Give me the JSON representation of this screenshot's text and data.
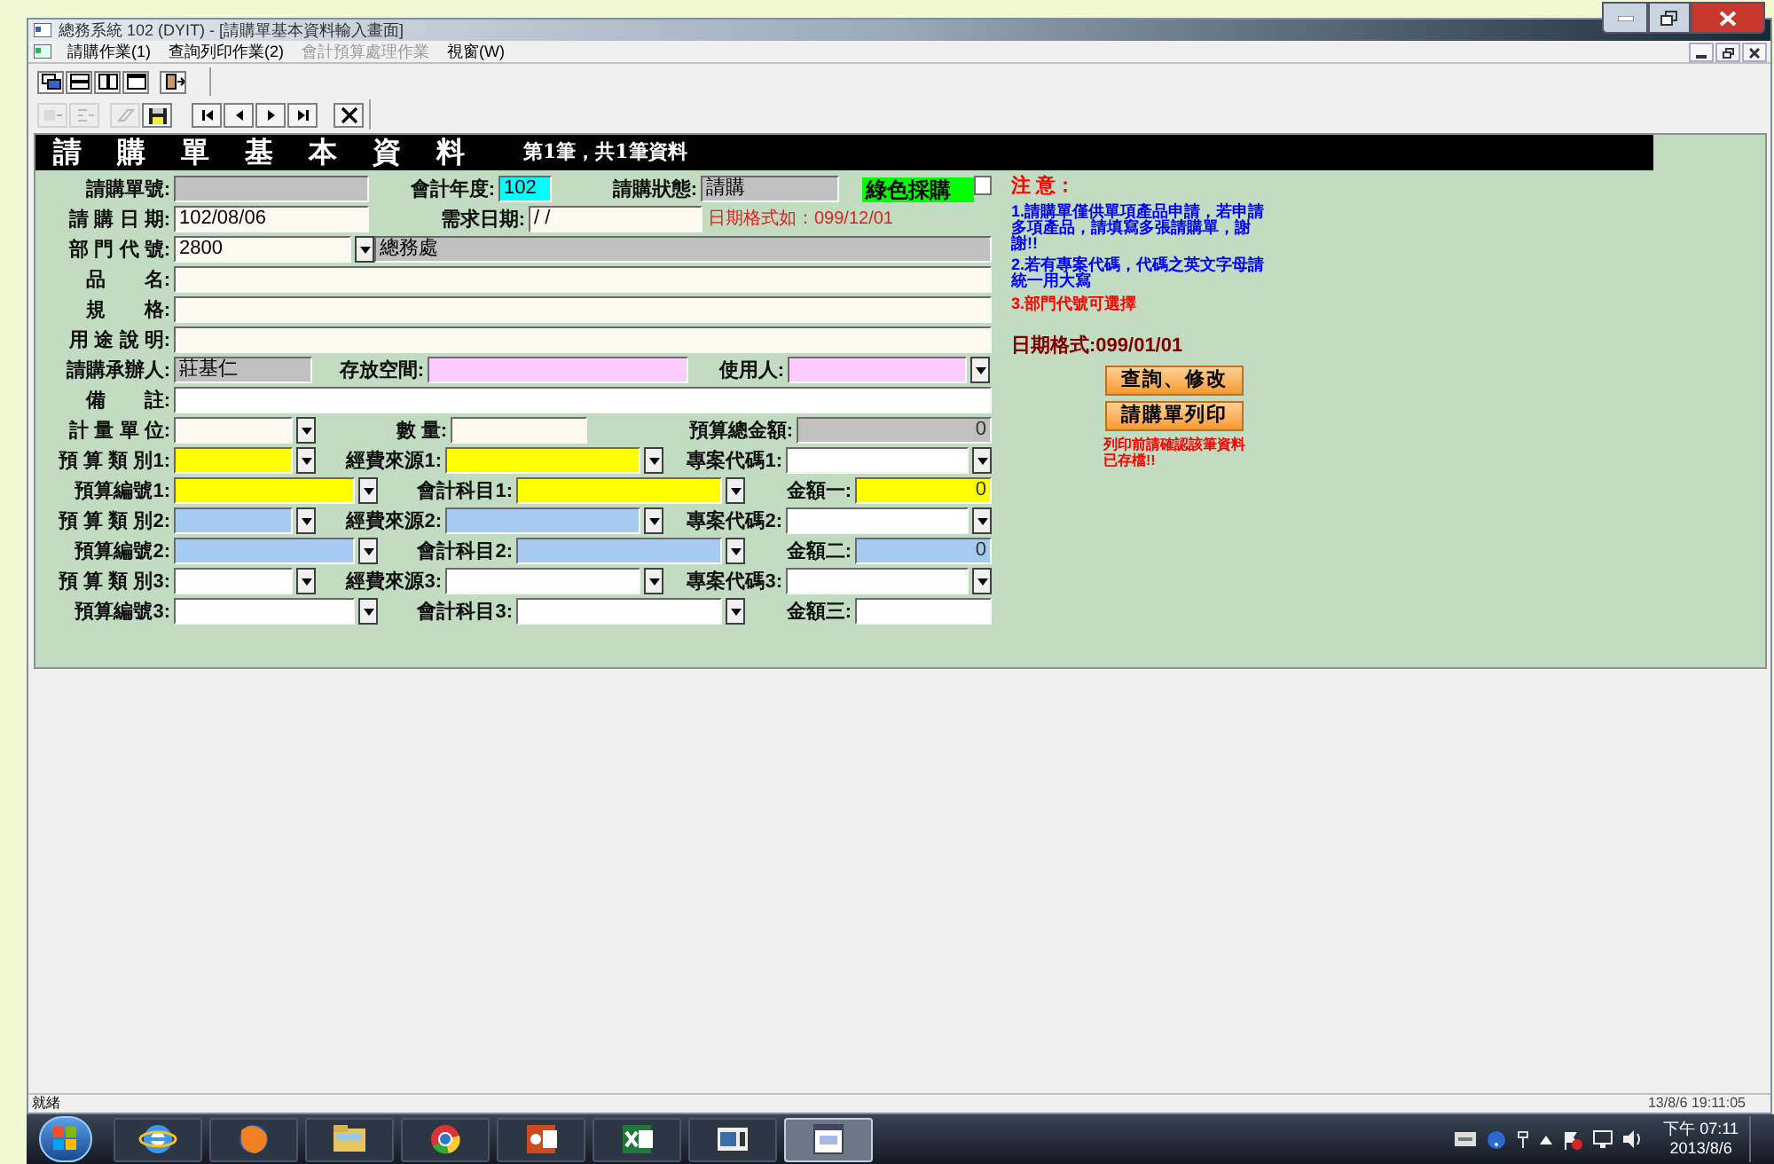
{
  "window": {
    "title": "總務系統 102 (DYIT) - [請購單基本資料輸入畫面]"
  },
  "menu": [
    {
      "label": "請購作業(1)",
      "disabled": false
    },
    {
      "label": "查詢列印作業(2)",
      "disabled": false
    },
    {
      "label": "會計預算處理作業",
      "disabled": true
    },
    {
      "label": "視窗(W)",
      "disabled": false
    }
  ],
  "toolbar_1": [
    {
      "kind": "cascade"
    },
    {
      "kind": "tile-h"
    },
    {
      "kind": "tile-v"
    },
    {
      "kind": "window"
    },
    {
      "kind": "exit"
    }
  ],
  "toolbar_2": [
    {
      "kind": "add",
      "disabled": true
    },
    {
      "kind": "list",
      "disabled": true
    },
    {
      "kind": "erase",
      "disabled": true
    },
    {
      "kind": "save",
      "disabled": false
    },
    {
      "kind": "first",
      "disabled": false
    },
    {
      "kind": "prev",
      "disabled": false
    },
    {
      "kind": "next",
      "disabled": false
    },
    {
      "kind": "last",
      "disabled": false
    },
    {
      "kind": "close",
      "disabled": false
    }
  ],
  "form": {
    "title": "請 購 單 基 本 資 料",
    "record_info": "第1筆，共1筆資料",
    "rows": [
      {
        "fields": [
          {
            "kind": "field",
            "label": "請購單號:",
            "color": "#c0c0c0"
          },
          {
            "kind": "field",
            "label": "會計年度:",
            "value": "102",
            "color": "#00ffff"
          },
          {
            "kind": "field",
            "label": "請購狀態:",
            "value": "請購",
            "color": "#c0c0c0"
          },
          {
            "kind": "check",
            "label": "綠色採購",
            "checked": false
          }
        ]
      },
      {
        "fields": [
          {
            "kind": "field",
            "label": "請 購 日 期:",
            "value": "102/08/06",
            "color": "#fffaf0"
          },
          {
            "kind": "field",
            "label": "需求日期:",
            "value": "/ /",
            "color": "#fffaf0"
          },
          {
            "kind": "hint",
            "label": "日期格式如：099/12/01"
          }
        ]
      },
      {
        "fields": [
          {
            "kind": "field",
            "label": "部 門 代 號:",
            "value": "2800",
            "color": "#fffaf0",
            "dropdown": true
          },
          {
            "kind": "field",
            "value": "總務處",
            "color": "#c0c0c0"
          }
        ]
      },
      {
        "fields": [
          {
            "kind": "field",
            "label": "品　　名:",
            "color": "#fffaf0"
          }
        ]
      },
      {
        "fields": [
          {
            "kind": "field",
            "label": "規　　格:",
            "color": "#fffaf0"
          }
        ]
      },
      {
        "fields": [
          {
            "kind": "field",
            "label": "用 途 說 明:",
            "color": "#fffaf0"
          }
        ]
      },
      {
        "fields": [
          {
            "kind": "field",
            "label": "請購承辦人:",
            "value": "莊基仁",
            "color": "#c0c0c0"
          },
          {
            "kind": "field",
            "label": "存放空間:",
            "color": "#ffccff"
          },
          {
            "kind": "field",
            "label": "使用人:",
            "color": "#ffccff",
            "dropdown": true
          }
        ]
      },
      {
        "fields": [
          {
            "kind": "field",
            "label": "備　　註:",
            "color": "#ffffff"
          }
        ]
      },
      {
        "fields": [
          {
            "kind": "field",
            "label": "計 量 單 位:",
            "color": "#fffaf0",
            "dropdown": true
          },
          {
            "kind": "field",
            "label": "數 量:",
            "color": "#fffaf0"
          },
          {
            "kind": "amount",
            "label": "預算總金額:",
            "value": "0",
            "color": "#c0c0c0"
          }
        ]
      },
      {
        "fields": [
          {
            "kind": "field",
            "label": "預 算 類 別1:",
            "color": "#ffff00",
            "dropdown": true
          },
          {
            "kind": "field",
            "label": "經費來源1:",
            "color": "#ffff00",
            "dropdown": true
          },
          {
            "kind": "field",
            "label": "專案代碼1:",
            "color": "#ffffff",
            "dropdown": true
          }
        ]
      },
      {
        "fields": [
          {
            "kind": "field",
            "label": "預算編號1:",
            "color": "#ffff00",
            "dropdown": true
          },
          {
            "kind": "field",
            "label": "會計科目1:",
            "color": "#ffff00",
            "dropdown": true
          },
          {
            "kind": "amount",
            "label": "金額一:",
            "value": "0",
            "color": "#ffff00"
          }
        ]
      },
      {
        "fields": [
          {
            "kind": "field",
            "label": "預 算 類 別2:",
            "color": "#a6caf0",
            "dropdown": true
          },
          {
            "kind": "field",
            "label": "經費來源2:",
            "color": "#a6caf0",
            "dropdown": true
          },
          {
            "kind": "field",
            "label": "專案代碼2:",
            "color": "#ffffff",
            "dropdown": true
          }
        ]
      },
      {
        "fields": [
          {
            "kind": "field",
            "label": "預算編號2:",
            "color": "#a6caf0",
            "dropdown": true
          },
          {
            "kind": "field",
            "label": "會計科目2:",
            "color": "#a6caf0",
            "dropdown": true
          },
          {
            "kind": "amount",
            "label": "金額二:",
            "value": "0",
            "color": "#a6caf0"
          }
        ]
      },
      {
        "fields": [
          {
            "kind": "field",
            "label": "預 算 類 別3:",
            "color": "#ffffff",
            "dropdown": true
          },
          {
            "kind": "field",
            "label": "經費來源3:",
            "color": "#ffffff",
            "dropdown": true
          },
          {
            "kind": "field",
            "label": "專案代碼3:",
            "color": "#ffffff",
            "dropdown": true
          }
        ]
      },
      {
        "fields": [
          {
            "kind": "field",
            "label": "預算編號3:",
            "color": "#ffffff",
            "dropdown": true
          },
          {
            "kind": "field",
            "label": "會計科目3:",
            "color": "#ffffff",
            "dropdown": true
          },
          {
            "kind": "amount",
            "label": "金額三:",
            "color": "#ffffff"
          }
        ]
      }
    ],
    "notes": [
      {
        "text": "注 意：",
        "color": "#ff0000"
      },
      {
        "text": "1.請購單僅供單項產品申請，若申請多項產品，請填寫多張請購單，謝謝!!",
        "color": "#0000ff"
      },
      {
        "text": "2.若有專案代碼，代碼之英文字母請統一用大寫",
        "color": "#0000ff"
      },
      {
        "text": "3.部門代號可選擇",
        "color": "#ff0000"
      },
      {
        "text": "日期格式:099/01/01",
        "color": "#800000"
      }
    ],
    "buttons": [
      "查詢、修改",
      "請購單列印"
    ],
    "print_warning": "列印前請確認該筆資料已存檔!!"
  },
  "status_bar": {
    "text": "就緒",
    "datetime": "13/8/6 19:11:05"
  },
  "taskbar": {
    "apps": [
      {
        "kind": "ie"
      },
      {
        "kind": "firefox"
      },
      {
        "kind": "folder"
      },
      {
        "kind": "chrome"
      },
      {
        "kind": "powerpoint"
      },
      {
        "kind": "excel"
      },
      {
        "kind": "window"
      },
      {
        "kind": "form",
        "selected": true
      }
    ],
    "time": "下午 07:11",
    "date": "2013/8/6"
  }
}
